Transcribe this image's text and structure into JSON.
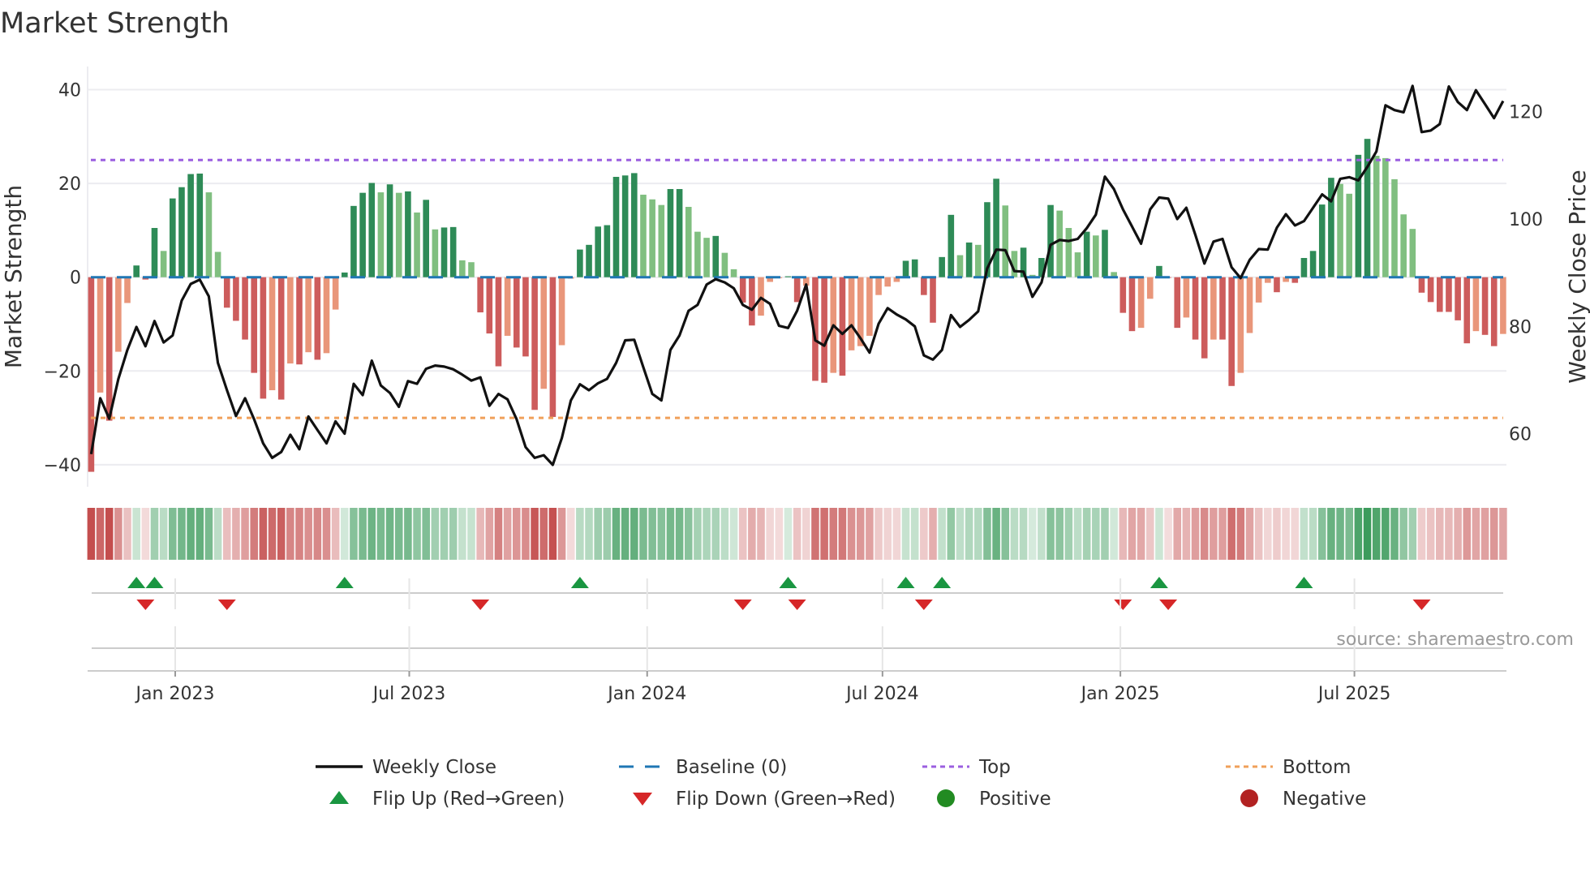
{
  "chart_data": {
    "type": "bar+line",
    "title": "Market Strength",
    "ylabel": "Market Strength",
    "y2label": "Weekly Close Price",
    "ylim": [
      -45,
      45
    ],
    "y2lim": [
      50,
      127
    ],
    "yticks": [
      "40",
      "20",
      "0",
      "−20",
      "−40"
    ],
    "ytick_values": [
      40,
      20,
      0,
      -20,
      -40
    ],
    "y2ticks": [
      "120",
      "100",
      "80",
      "60"
    ],
    "y2tick_values": [
      120,
      100,
      80,
      60
    ],
    "x_start": "2022-10-28",
    "x_step_days": 7,
    "xticks": [
      {
        "label": "Jan 2023",
        "date": "2023-01-01"
      },
      {
        "label": "Jul 2023",
        "date": "2023-07-01"
      },
      {
        "label": "Jan 2024",
        "date": "2024-01-01"
      },
      {
        "label": "Jul 2024",
        "date": "2024-07-01"
      },
      {
        "label": "Jan 2025",
        "date": "2025-01-01"
      },
      {
        "label": "Jul 2025",
        "date": "2025-07-01"
      }
    ],
    "top_level": 25,
    "bottom_level": -30,
    "baseline": 0,
    "strength": [
      -41.5,
      -24.6,
      -30.6,
      -15.9,
      -5.5,
      2.5,
      -0.5,
      10.5,
      5.6,
      16.8,
      19.2,
      22,
      22.1,
      18.1,
      5.4,
      -6.5,
      -9.3,
      -13.3,
      -20.4,
      -25.9,
      -24.1,
      -26.1,
      -18.4,
      -18.6,
      -16,
      -17.6,
      -16.2,
      -6.9,
      1,
      15.2,
      18,
      20.1,
      18.1,
      19.8,
      18,
      18.3,
      13.8,
      16.5,
      10.2,
      10.6,
      10.7,
      3.6,
      3.2,
      -7.5,
      -12,
      -19,
      -12.5,
      -15,
      -16.9,
      -28.3,
      -23.8,
      -29.8,
      -14.5,
      -0.3,
      5.9,
      6.9,
      10.8,
      11.1,
      21.4,
      21.7,
      22.2,
      17.6,
      16.6,
      15.4,
      18.8,
      18.8,
      15,
      9.7,
      8.4,
      8.8,
      5.2,
      1.7,
      -5.4,
      -10.3,
      -8.2,
      -1,
      -0.2,
      0.2,
      -5.3,
      -1.8,
      -22.1,
      -22.5,
      -20.4,
      -21,
      -15.6,
      -14.7,
      -12.5,
      -3.8,
      -2,
      -1,
      3.5,
      3.8,
      -3.8,
      -9.7,
      4.3,
      13.3,
      4.7,
      7.4,
      6.9,
      16,
      21,
      15.3,
      5.6,
      6.3,
      0.5,
      4.1,
      15.4,
      14.2,
      10.5,
      5.3,
      9.7,
      8.9,
      10.1,
      1.1,
      -7.6,
      -11.5,
      -10.8,
      -4.6,
      2.4,
      -0.1,
      -10.8,
      -8.6,
      -13.3,
      -17.3,
      -13.3,
      -13.3,
      -23.2,
      -20.4,
      -11.9,
      -5.4,
      -1.2,
      -3.2,
      -1,
      -1.2,
      4.1,
      5.6,
      15.5,
      21.2,
      19.9,
      17.8,
      26.1,
      29.5,
      25.9,
      25.4,
      20.9,
      13.4,
      10.3,
      -3.3,
      -5.3,
      -7.4,
      -7.4,
      -9.2,
      -14.1,
      -11.5,
      -12.3,
      -14.7,
      -12.1
    ],
    "close": [
      56.2,
      66.6,
      62.8,
      70.2,
      75.6,
      79.9,
      76.3,
      81,
      77,
      78.3,
      84.8,
      87.9,
      88.7,
      85.6,
      73.2,
      68.1,
      63.3,
      66.6,
      62.7,
      58.2,
      55.5,
      56.6,
      59.8,
      57.1,
      63.2,
      60.7,
      58.2,
      62.3,
      60,
      69.3,
      67.2,
      73.6,
      69,
      67.6,
      65,
      69.8,
      69.3,
      72.1,
      72.7,
      72.5,
      72,
      71,
      69.9,
      70.5,
      65.2,
      67.4,
      66.4,
      62.7,
      57.5,
      55.5,
      56,
      54.2,
      59.2,
      66.2,
      69.2,
      68.1,
      69.4,
      70.2,
      73.2,
      77.4,
      77.5,
      72.4,
      67.4,
      66.2,
      75.6,
      78.3,
      82.9,
      84,
      87.8,
      88.8,
      88.2,
      87.1,
      84,
      83.1,
      85.3,
      84.2,
      80.1,
      79.7,
      82.9,
      87.8,
      77.4,
      76.4,
      80.2,
      78.6,
      80.2,
      77.8,
      75.1,
      80.5,
      83.4,
      82.2,
      81.3,
      80,
      74.6,
      73.8,
      75.6,
      82.1,
      79.9,
      81.2,
      82.8,
      90.8,
      94.3,
      94.2,
      90.3,
      90.2,
      85.5,
      88.2,
      95.2,
      96.1,
      95.9,
      96.3,
      98.3,
      100.8,
      107.9,
      105.6,
      101.8,
      98.6,
      95.4,
      101.8,
      104,
      103.8,
      100,
      102.1,
      97,
      91.7,
      95.8,
      96.3,
      91,
      89,
      92.4,
      94.4,
      94.3,
      98.4,
      100.9,
      98.8,
      99.6,
      102.1,
      104.6,
      103.3,
      107.5,
      107.8,
      107.2,
      109.7,
      112.6,
      121.2,
      120.3,
      119.9,
      124.8,
      116.2,
      116.5,
      117.7,
      124.7,
      121.8,
      120.3,
      124,
      121.4,
      118.8,
      122
    ],
    "colors": {
      "pos_strong": "#2e8b57",
      "pos_weak": "#80bf80",
      "neg_strong": "#cd5c5c",
      "neg_weak": "#e9967a",
      "top": "#9b5fe0",
      "bottom": "#f0a05a",
      "baseline": "#1f77b4",
      "line": "#111111",
      "flip_up": "#1a9641",
      "flip_down": "#d62728",
      "positive": "#228b22",
      "negative": "#b22222"
    },
    "legend": [
      {
        "key": "close",
        "label": "Weekly Close"
      },
      {
        "key": "baseline",
        "label": "Baseline (0)"
      },
      {
        "key": "top",
        "label": "Top"
      },
      {
        "key": "bottom",
        "label": "Bottom"
      },
      {
        "key": "flip_up",
        "label": "Flip Up (Red→Green)"
      },
      {
        "key": "flip_down",
        "label": "Flip Down (Green→Red)"
      },
      {
        "key": "positive",
        "label": "Positive"
      },
      {
        "key": "negative",
        "label": "Negative"
      }
    ],
    "legend_position": "bottom-center"
  },
  "source": "source: sharemaestro.com"
}
